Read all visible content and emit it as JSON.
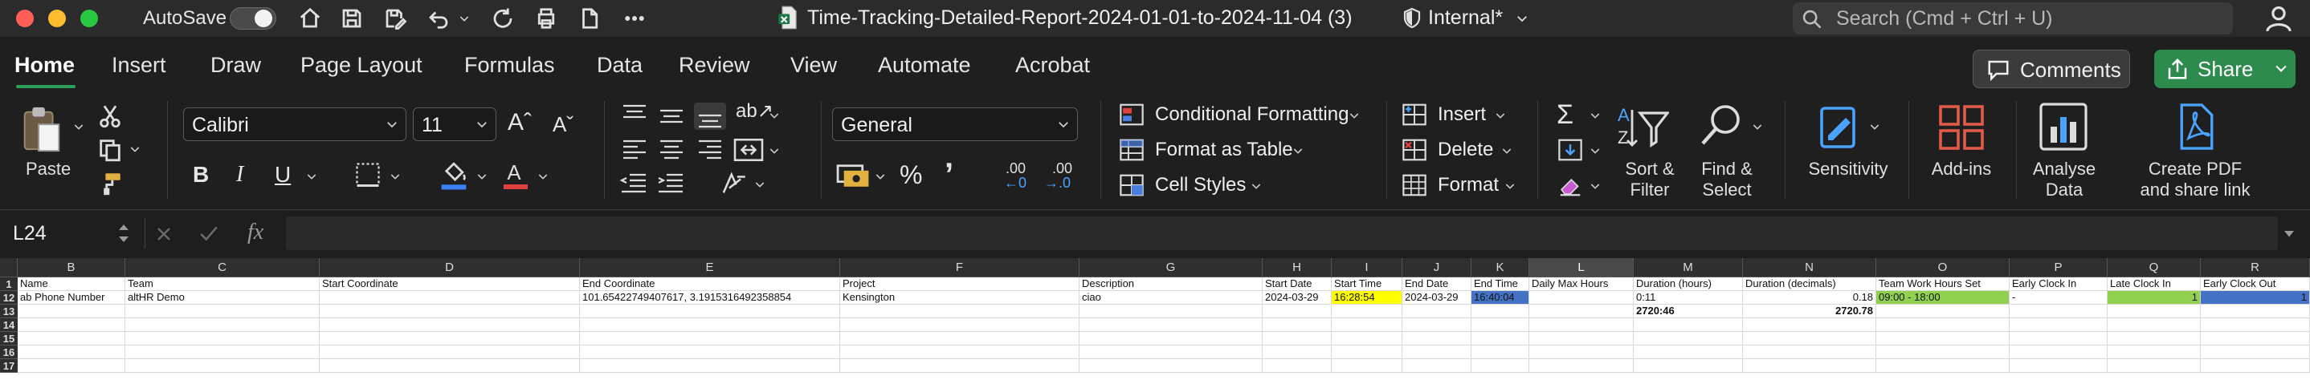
{
  "titlebar": {
    "autosave_label": "AutoSave",
    "document_title": "Time-Tracking-Detailed-Report-2024-01-01-to-2024-11-04 (3)",
    "sensitivity_label": "Internal*",
    "search_placeholder": "Search (Cmd + Ctrl + U)"
  },
  "tabs": [
    "Home",
    "Insert",
    "Draw",
    "Page Layout",
    "Formulas",
    "Data",
    "Review",
    "View",
    "Automate",
    "Acrobat"
  ],
  "buttons": {
    "comments": "Comments",
    "share": "Share"
  },
  "ribbon": {
    "paste": "Paste",
    "font_name": "Calibri",
    "font_size": "11",
    "number_format": "General",
    "conditional_formatting": "Conditional Formatting",
    "format_as_table": "Format as Table",
    "cell_styles": "Cell Styles",
    "insert": "Insert",
    "delete": "Delete",
    "format": "Format",
    "sort_filter_1": "Sort &",
    "sort_filter_2": "Filter",
    "find_select_1": "Find &",
    "find_select_2": "Select",
    "sensitivity": "Sensitivity",
    "add_ins": "Add-ins",
    "analyse_1": "Analyse",
    "analyse_2": "Data",
    "create_pdf_1": "Create PDF",
    "create_pdf_2": "and share link",
    "bold": "B",
    "italic": "I",
    "underline": "U",
    "percent": "%",
    "comma": "’",
    "decimal_inc": ".00",
    "decimal_dec": ".00"
  },
  "formula_bar": {
    "name_box": "L24",
    "fx": "fx",
    "content": ""
  },
  "grid": {
    "columns": [
      "B",
      "C",
      "D",
      "E",
      "F",
      "G",
      "H",
      "I",
      "J",
      "K",
      "L",
      "M",
      "N",
      "O",
      "P",
      "Q",
      "R"
    ],
    "rows": [
      "1",
      "12",
      "13",
      "14",
      "15",
      "16",
      "17"
    ],
    "header_row": [
      "ab Phone Number",
      "Team",
      "Start Coordinate",
      "End Coordinate",
      "Project",
      "Description",
      "Start Date",
      "Start Time",
      "End Date",
      "End Time",
      "Daily Max Hours",
      "Duration (hours)",
      "Duration (decimals)",
      "Team Work Hours Set",
      "Early Clock In",
      "Late Clock In",
      "Early Clock Out"
    ],
    "row12": [
      "ab Phone Number",
      "altHR Demo",
      "",
      "101.65422749407617, 3.1915316492358854",
      "Kensington",
      "ciao",
      "2024-03-29",
      "16:28:54",
      "2024-03-29",
      "16:40:04",
      "",
      "0:11",
      "0.18",
      "09:00 - 18:00",
      "-",
      "1",
      "1"
    ],
    "row13_m": "2720:46",
    "row13_n": "2720.78",
    "header_b": "Name"
  },
  "colors": {
    "accent_green": "#2e8b4e",
    "yellow_fill": "#ffff00",
    "blue_fill": "#4472c4",
    "green_fill": "#92d050"
  }
}
